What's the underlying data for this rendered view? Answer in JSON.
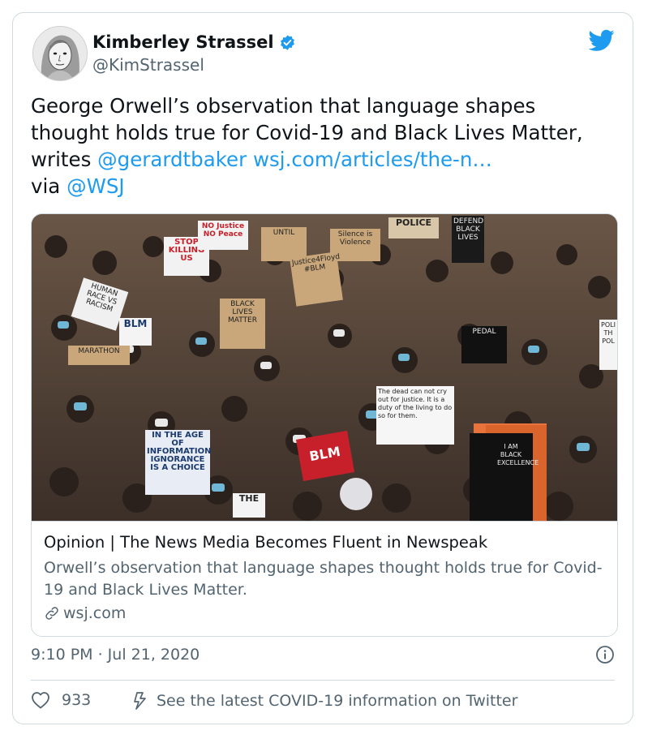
{
  "author": {
    "name": "Kimberley Strassel",
    "handle": "@KimStrassel"
  },
  "tweet": {
    "text_before": "George Orwell’s observation that language shapes thought holds true for Covid-19 and Black Lives Matter, writes ",
    "mention1": "@gerardtbaker",
    "url": "wsj.com/articles/the-n…",
    "via": " via ",
    "mention2": "@WSJ"
  },
  "card": {
    "title": "Opinion | The News Media Becomes Fluent in Newspeak",
    "description": "Orwell’s observation that language shapes thought holds true for Covid-19 and Black Lives Matter.",
    "domain": "wsj.com"
  },
  "photo_signs": {
    "stop_killing": "STOP KILLING US",
    "no_justice": "NO Justice NO Peace",
    "until": "UNTIL",
    "silence": "Silence is Violence",
    "police": "POLICE",
    "defend": "DEFEND BLACK LIVES",
    "human_race": "HUMAN RACE VS RACISM",
    "blm1": "BLM",
    "black_lives": "BLACK LIVES MATTER",
    "justice": "Justice4Floyd #BLM",
    "marathon": "MARATHON",
    "pedal": "PEDAL",
    "dead": "The dead can not cry out for justice. It is a duty of the living to do so for them.",
    "blm2": "BLM",
    "in_the_age": "IN THE AGE OF INFORMATION IGNORANCE IS A CHOICE",
    "black_excellence": "I AM BLACK EXCELLENCE",
    "the": "THE",
    "poli": "POLI TH POL"
  },
  "meta": {
    "timestamp": "9:10 PM · Jul 21, 2020",
    "likes": "933",
    "covid_notice": "See the latest COVID-19 information on Twitter"
  },
  "colors": {
    "link": "#1d9bf0",
    "secondary_text": "#536471",
    "border": "#cfd9de",
    "blm_sign": "#c8202a"
  }
}
